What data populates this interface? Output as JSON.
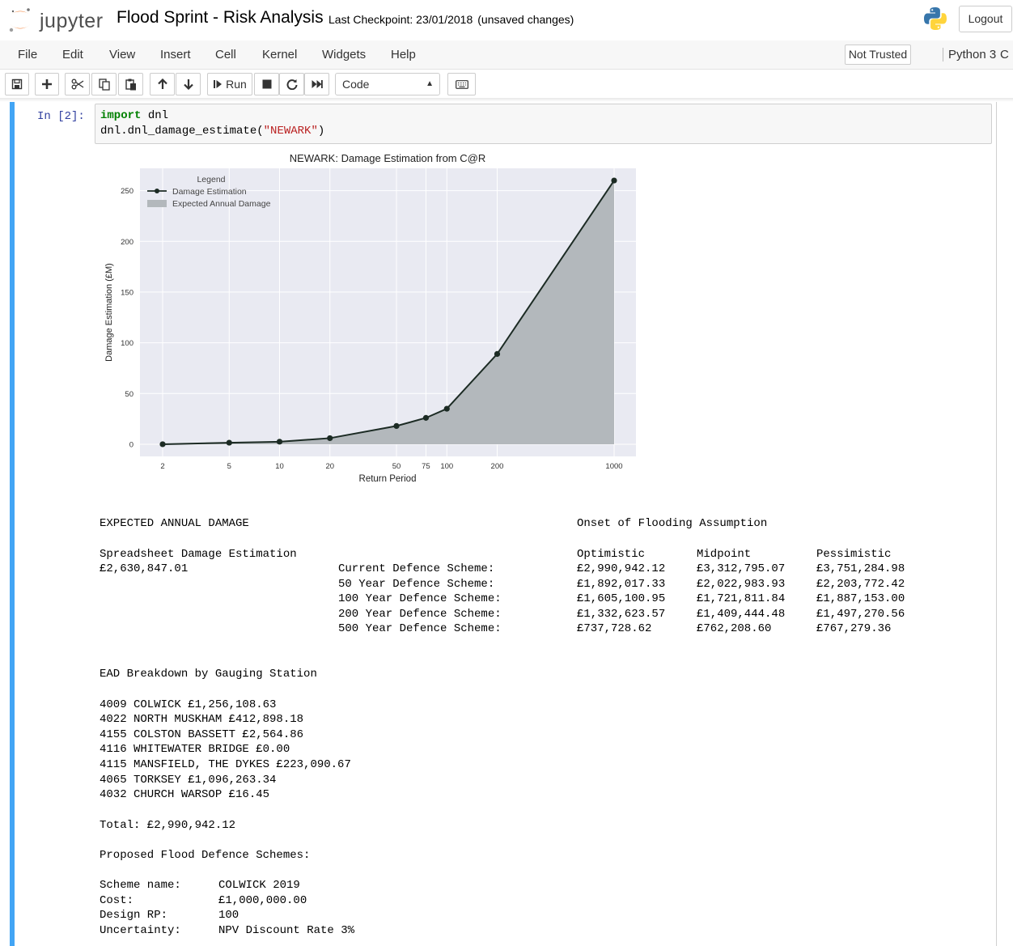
{
  "header": {
    "logo_text": "jupyter",
    "notebook_name": "Flood Sprint - Risk Analysis",
    "checkpoint": "Last Checkpoint: 23/01/2018",
    "status": "(unsaved changes)",
    "logout_label": "Logout"
  },
  "menubar": {
    "items": [
      "File",
      "Edit",
      "View",
      "Insert",
      "Cell",
      "Kernel",
      "Widgets",
      "Help"
    ],
    "trusted": "Not Trusted",
    "kernel": "Python 3",
    "kernel_indicator": "C"
  },
  "toolbar": {
    "run_label": "Run",
    "cell_type": "Code",
    "icons": [
      "save-icon",
      "plus-icon",
      "scissors-icon",
      "copy-icon",
      "paste-icon",
      "arrow-up-icon",
      "arrow-down-icon",
      "run-icon",
      "stop-icon",
      "restart-icon",
      "fast-forward-icon",
      "keyboard-icon"
    ]
  },
  "cell": {
    "prompt": "In [2]:",
    "code": {
      "line1_kw": "import",
      "line1_rest": " dnl",
      "line2_call": "dnl.dnl_damage_estimate",
      "line2_open": "(",
      "line2_arg": "\"NEWARK\"",
      "line2_close": ")"
    }
  },
  "chart_data": {
    "type": "line",
    "title": "NEWARK: Damage Estimation from C@R",
    "xlabel": "Return Period",
    "ylabel": "Damage Estimation (£M)",
    "x_scale": "log",
    "x_ticks": [
      2,
      5,
      10,
      20,
      50,
      75,
      100,
      200,
      1000
    ],
    "y_ticks": [
      0,
      50,
      100,
      150,
      200,
      250
    ],
    "ylim": [
      -12,
      272
    ],
    "grid": true,
    "legend": {
      "title": "Legend",
      "placement": "top-left",
      "entries": [
        "Damage Estimation",
        "Expected Annual Damage"
      ]
    },
    "series": [
      {
        "name": "Damage Estimation",
        "x": [
          2,
          5,
          10,
          20,
          50,
          75,
          100,
          200,
          1000
        ],
        "y": [
          0,
          1.5,
          2.5,
          6,
          18,
          26,
          35,
          89,
          260
        ]
      }
    ],
    "fill": "Expected Annual Damage",
    "colors": {
      "line": "#1c2b24",
      "fill": "#b3b8bc",
      "plot_bg": "#e9eaf2"
    }
  },
  "output": {
    "ead_title": "EXPECTED ANNUAL DAMAGE",
    "onset_title": "Onset of Flooding Assumption",
    "spreadsheet_label": "Spreadsheet Damage Estimation",
    "spreadsheet_value": "£2,630,847.01",
    "scenario_headers": [
      "Optimistic",
      "Midpoint",
      "Pessimistic"
    ],
    "schemes": [
      {
        "name": "Current Defence Scheme:",
        "values": [
          "£2,990,942.12",
          "£3,312,795.07",
          "£3,751,284.98"
        ]
      },
      {
        "name": "50 Year Defence Scheme:",
        "values": [
          "£1,892,017.33",
          "£2,022,983.93",
          "£2,203,772.42"
        ]
      },
      {
        "name": "100 Year Defence Scheme:",
        "values": [
          "£1,605,100.95",
          "£1,721,811.84",
          "£1,887,153.00"
        ]
      },
      {
        "name": "200 Year Defence Scheme:",
        "values": [
          "£1,332,623.57",
          "£1,409,444.48",
          "£1,497,270.56"
        ]
      },
      {
        "name": "500 Year Defence Scheme:",
        "values": [
          "£737,728.62",
          "£762,208.60",
          "£767,279.36"
        ]
      }
    ],
    "breakdown_title": "EAD Breakdown by Gauging Station",
    "stations": [
      "4009 COLWICK £1,256,108.63",
      "4022 NORTH MUSKHAM £412,898.18",
      "4155 COLSTON BASSETT £2,564.86",
      "4116 WHITEWATER BRIDGE £0.00",
      "4115 MANSFIELD, THE DYKES £223,090.67",
      "4065 TORKSEY £1,096,263.34",
      "4032 CHURCH WARSOP £16.45"
    ],
    "total": "Total: £2,990,942.12",
    "proposed_title": "Proposed Flood Defence Schemes:",
    "proposed": [
      {
        "label": "Scheme name:",
        "value": "COLWICK 2019"
      },
      {
        "label": "Cost:",
        "value": "£1,000,000.00"
      },
      {
        "label": "Design RP:",
        "value": "100"
      },
      {
        "label": "Uncertainty:",
        "value": "NPV Discount Rate 3%"
      }
    ]
  }
}
